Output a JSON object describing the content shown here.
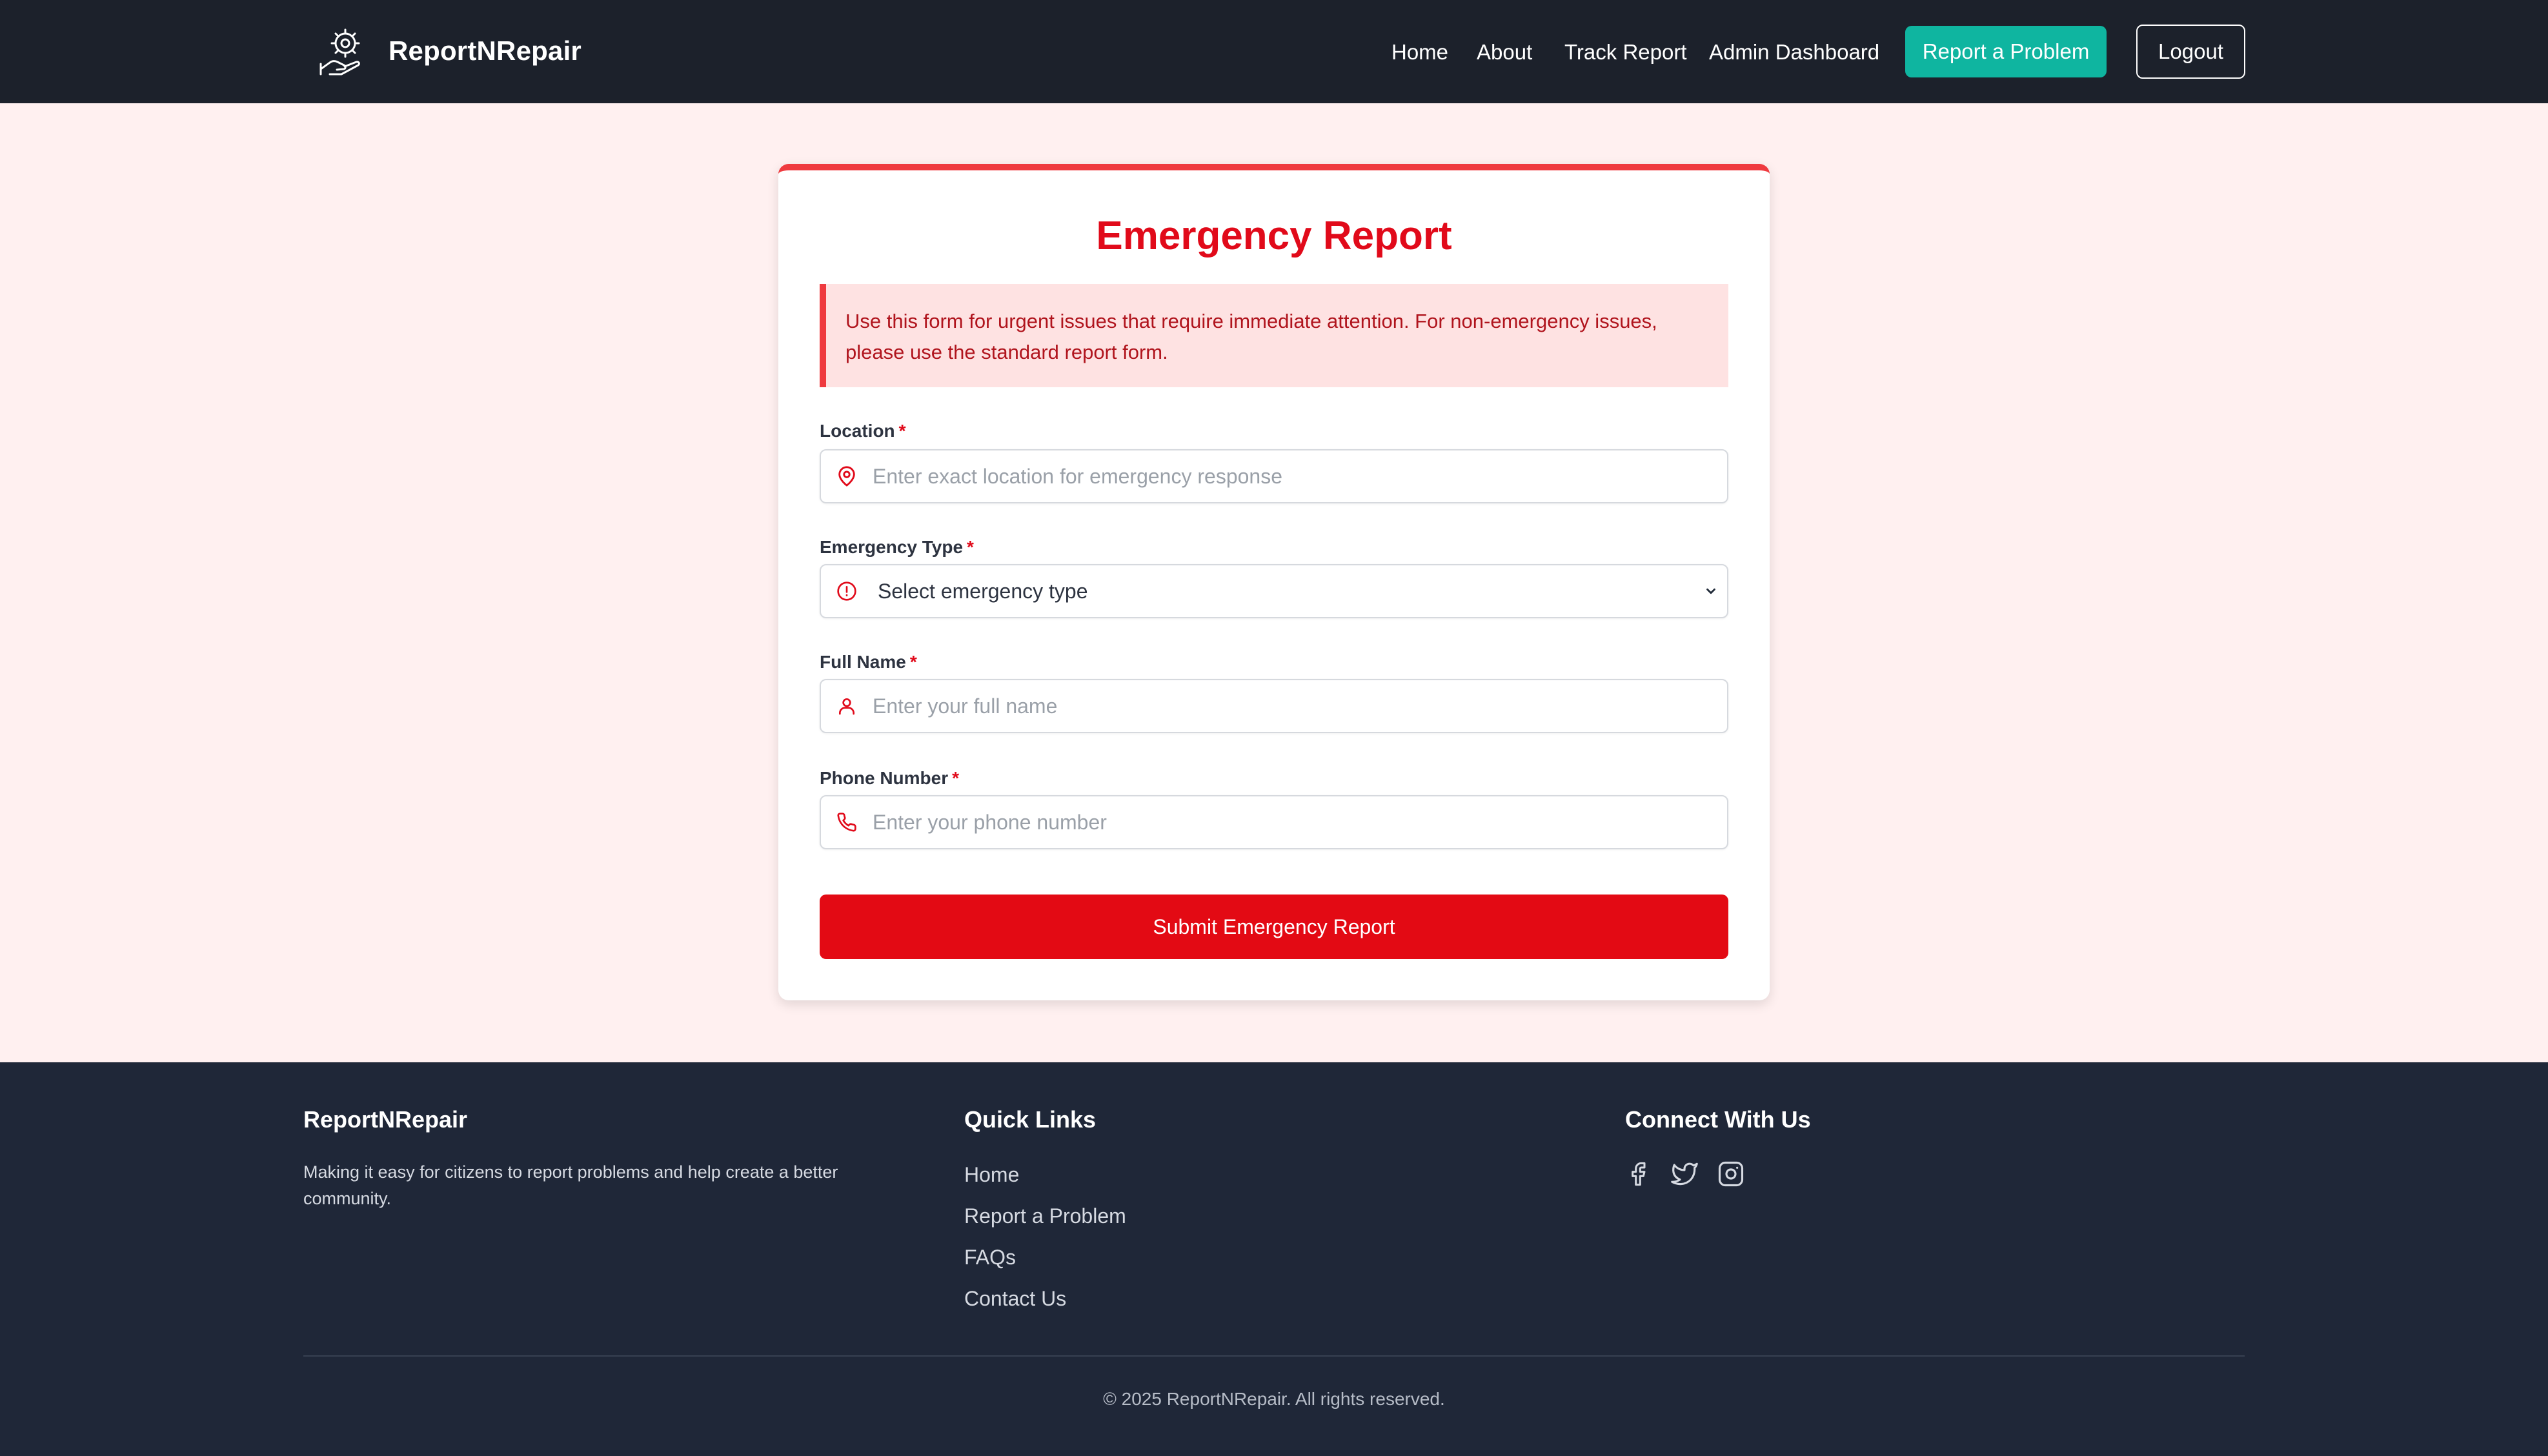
{
  "colors": {
    "navbar_bg": "#1c212b",
    "page_bg": "#fff0f0",
    "accent_red": "#e10a1a",
    "teal": "#0fb5a0",
    "footer_bg": "#1f2738"
  },
  "nav": {
    "brand": "ReportNRepair",
    "logo_icon": "gear-hand-icon",
    "links": [
      "Home",
      "About",
      "Track Report",
      "Admin Dashboard"
    ],
    "report_button": "Report a Problem",
    "logout_button": "Logout"
  },
  "form": {
    "title": "Emergency Report",
    "alert": "Use this form for urgent issues that require immediate attention. For non-emergency issues, please use the standard report form.",
    "required_marker": "*",
    "location": {
      "label": "Location",
      "placeholder": "Enter exact location for emergency response",
      "icon": "map-pin-icon"
    },
    "emergency_type": {
      "label": "Emergency Type",
      "selected": "Select emergency type",
      "icon": "alert-circle-icon"
    },
    "full_name": {
      "label": "Full Name",
      "placeholder": "Enter your full name",
      "icon": "user-icon"
    },
    "phone": {
      "label": "Phone Number",
      "placeholder": "Enter your phone number",
      "icon": "phone-icon"
    },
    "submit": "Submit Emergency Report"
  },
  "footer": {
    "brand": "ReportNRepair",
    "description": "Making it easy for citizens to report problems and help create a better community.",
    "quick_links_title": "Quick Links",
    "quick_links": [
      "Home",
      "Report a Problem",
      "FAQs",
      "Contact Us"
    ],
    "connect_title": "Connect With Us",
    "social_icons": [
      "facebook-icon",
      "twitter-icon",
      "instagram-icon"
    ],
    "copyright": "© 2025 ReportNRepair. All rights reserved."
  }
}
